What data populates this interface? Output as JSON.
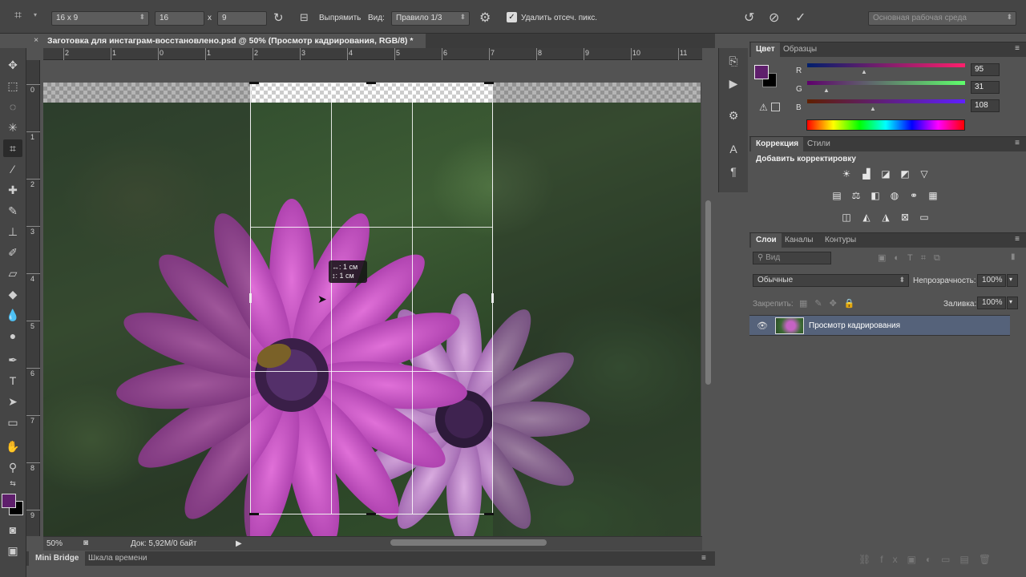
{
  "options_bar": {
    "ratio_preset": "16 x 9",
    "width_value": "16",
    "x_separator": "x",
    "height_value": "9",
    "straighten_label": "Выпрямить",
    "view_label": "Вид:",
    "view_value": "Правило 1/3",
    "delete_pixels_label": "Удалить отсеч. пикс.",
    "delete_pixels_checked": true,
    "workspace": "Основная рабочая среда"
  },
  "document": {
    "tab_title": "Заготовка для инстаграм-восстановлено.psd @ 50% (Просмотр кадрирования, RGB/8) *",
    "close_glyph": "×"
  },
  "rulers": {
    "horizontal": [
      "2",
      "1",
      "0",
      "1",
      "2",
      "3",
      "4",
      "5",
      "6",
      "7",
      "8",
      "9",
      "10",
      "11"
    ],
    "vertical": [
      "0",
      "1",
      "2",
      "3",
      "4",
      "5",
      "6",
      "7",
      "8",
      "9"
    ]
  },
  "crop_tooltip": {
    "line1": "↔: 1 см",
    "line2": "↕: 1 см"
  },
  "status": {
    "zoom": "50%",
    "doc_size": "Док: 5,92M/0 байт"
  },
  "bottom_tabs": [
    "Mini Bridge",
    "Шкала времени"
  ],
  "color_panel": {
    "tabs": [
      "Цвет",
      "Образцы"
    ],
    "channels": [
      {
        "name": "R",
        "value": "95"
      },
      {
        "name": "G",
        "value": "31"
      },
      {
        "name": "B",
        "value": "108"
      }
    ],
    "foreground": "#5f1f6c",
    "background": "#000000"
  },
  "adjustments_panel": {
    "tabs": [
      "Коррекция",
      "Стили"
    ],
    "title": "Добавить корректировку"
  },
  "layers_panel": {
    "tabs": [
      "Слои",
      "Каналы",
      "Контуры"
    ],
    "filter_placeholder": "Вид",
    "blend_mode": "Обычные",
    "opacity_label": "Непрозрачность:",
    "opacity_value": "100%",
    "lock_label": "Закрепить:",
    "fill_label": "Заливка:",
    "fill_value": "100%",
    "layers": [
      {
        "name": "Просмотр кадрирования",
        "visible": true,
        "selected": true
      }
    ]
  }
}
